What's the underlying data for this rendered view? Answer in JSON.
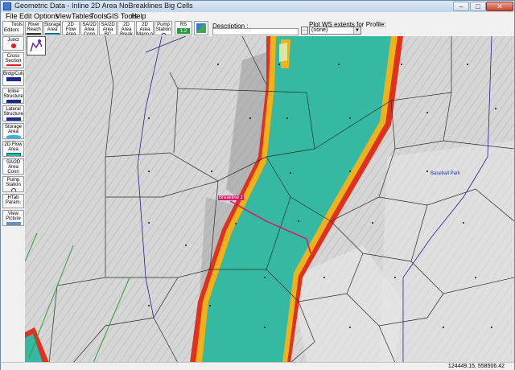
{
  "window": {
    "title": "Geometric Data - Inline 2D Area NoBreaklines Big Cells",
    "minimize": "–",
    "maximize": "□",
    "close": "✕"
  },
  "menu": [
    "File",
    "Edit",
    "Options",
    "View",
    "Tables",
    "Tools",
    "GIS Tools",
    "Help"
  ],
  "toolbar": {
    "tools_label": "Tools",
    "editors_label": "Editors",
    "buttons": [
      {
        "label": "River Reach",
        "icon": "river-reach-icon"
      },
      {
        "label": "Storage Area",
        "icon": "storage-area-icon"
      },
      {
        "label": "2D Flow Area",
        "icon": "2d-flow-area-icon"
      },
      {
        "label": "SA/2D Area Conn",
        "icon": "sa2d-connection-icon"
      },
      {
        "label": "SA/2D Area BC Lines",
        "icon": "bc-lines-icon"
      },
      {
        "label": "2D Area Break Lines",
        "icon": "break-lines-icon"
      },
      {
        "label": "2D Area Mann n Regions",
        "icon": "manning-regions-icon"
      },
      {
        "label": "Pump Station",
        "icon": "pump-station-icon"
      }
    ],
    "rs_label": "RS",
    "rs_value": "1.2",
    "description_label": "Description :",
    "description_value": "",
    "description_button": "…",
    "plot_label": "Plot WS extents for Profile:",
    "profile_selected": "(none)"
  },
  "sidebar": [
    {
      "label": "Junct",
      "icon": "junction-icon"
    },
    {
      "label": "Cross Section",
      "icon": "cross-section-icon"
    },
    {
      "label": "Brdg/Culv",
      "icon": "bridge-culvert-icon"
    },
    {
      "label": "Inline Structure",
      "icon": "inline-structure-icon"
    },
    {
      "label": "Lateral Structure",
      "icon": "lateral-structure-icon"
    },
    {
      "label": "Storage Area",
      "icon": "storage-area-icon"
    },
    {
      "label": "2D Flow Area",
      "icon": "2d-flow-area-icon"
    },
    {
      "label": "SA/2D Area Conn",
      "icon": "sa2d-connection-icon"
    },
    {
      "label": "Pump Station",
      "icon": "pump-station-icon"
    },
    {
      "label": "HTab Param.",
      "icon": "htab-icon"
    },
    {
      "label": "View Picture",
      "icon": "view-picture-icon"
    }
  ],
  "map": {
    "breakline_label": "Breakline 1",
    "place_label": "Baseball Park"
  },
  "status": {
    "coordinates": "124449.15, 558506.42"
  },
  "colors": {
    "flood": "#35b9a2",
    "breakline": "#e0106a",
    "cell_lines": "#2a2a2a",
    "boundary": "#23238a",
    "place_label": "#1a39d6"
  }
}
